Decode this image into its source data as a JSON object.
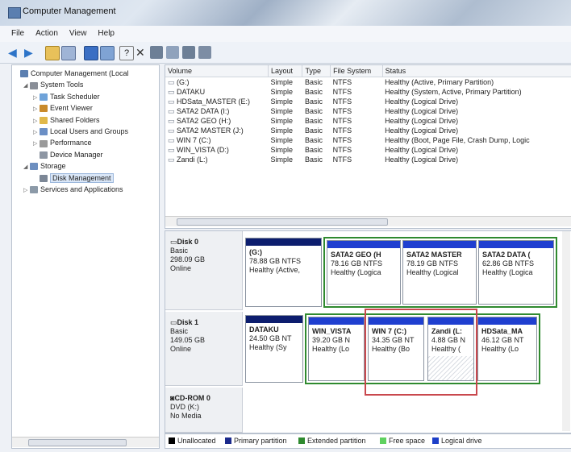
{
  "window": {
    "title": "Computer Management"
  },
  "menu": [
    "File",
    "Action",
    "View",
    "Help"
  ],
  "tree": [
    {
      "label": "Computer Management (Local",
      "level": 0,
      "icon": "computer-icon",
      "expander": ""
    },
    {
      "label": "System Tools",
      "level": 1,
      "icon": "tools-icon",
      "expander": "◢"
    },
    {
      "label": "Task Scheduler",
      "level": 2,
      "icon": "clock-icon",
      "expander": "▷"
    },
    {
      "label": "Event Viewer",
      "level": 2,
      "icon": "event-viewer-icon",
      "expander": "▷"
    },
    {
      "label": "Shared Folders",
      "level": 2,
      "icon": "folder-icon",
      "expander": "▷"
    },
    {
      "label": "Local Users and Groups",
      "level": 2,
      "icon": "users-icon",
      "expander": "▷"
    },
    {
      "label": "Performance",
      "level": 2,
      "icon": "performance-icon",
      "expander": "▷"
    },
    {
      "label": "Device Manager",
      "level": 2,
      "icon": "device-manager-icon",
      "expander": ""
    },
    {
      "label": "Storage",
      "level": 1,
      "icon": "storage-icon",
      "expander": "◢"
    },
    {
      "label": "Disk Management",
      "level": 2,
      "icon": "disk-icon",
      "expander": "",
      "selected": true
    },
    {
      "label": "Services and Applications",
      "level": 1,
      "icon": "services-icon",
      "expander": "▷"
    }
  ],
  "volumes": {
    "columns": [
      "Volume",
      "Layout",
      "Type",
      "File System",
      "Status"
    ],
    "rows": [
      [
        "(G:)",
        "Simple",
        "Basic",
        "NTFS",
        "Healthy (Active, Primary Partition)"
      ],
      [
        "DATAKU",
        "Simple",
        "Basic",
        "NTFS",
        "Healthy (System, Active, Primary Partition)"
      ],
      [
        "HDSata_MASTER (E:)",
        "Simple",
        "Basic",
        "NTFS",
        "Healthy (Logical Drive)"
      ],
      [
        "SATA2 DATA (I:)",
        "Simple",
        "Basic",
        "NTFS",
        "Healthy (Logical Drive)"
      ],
      [
        "SATA2 GEO (H:)",
        "Simple",
        "Basic",
        "NTFS",
        "Healthy (Logical Drive)"
      ],
      [
        "SATA2 MASTER (J:)",
        "Simple",
        "Basic",
        "NTFS",
        "Healthy (Logical Drive)"
      ],
      [
        "WIN 7 (C:)",
        "Simple",
        "Basic",
        "NTFS",
        "Healthy (Boot, Page File, Crash Dump, Logic"
      ],
      [
        "WIN_VISTA (D:)",
        "Simple",
        "Basic",
        "NTFS",
        "Healthy (Logical Drive)"
      ],
      [
        "Zandi (L:)",
        "Simple",
        "Basic",
        "NTFS",
        "Healthy (Logical Drive)"
      ]
    ]
  },
  "disks": [
    {
      "name": "Disk 0",
      "type": "Basic",
      "size": "298.09 GB",
      "status": "Online",
      "partitions": [
        {
          "name": "(G:)",
          "size": "78.88 GB NTFS",
          "status": "Healthy (Active,"
        },
        {
          "name": "SATA2 GEO (H",
          "size": "78.16 GB NTFS",
          "status": "Healthy (Logica"
        },
        {
          "name": "SATA2 MASTER",
          "size": "78.19 GB NTFS",
          "status": "Healthy (Logical"
        },
        {
          "name": "SATA2 DATA (",
          "size": "62.86 GB NTFS",
          "status": "Healthy (Logica"
        }
      ]
    },
    {
      "name": "Disk 1",
      "type": "Basic",
      "size": "149.05 GB",
      "status": "Online",
      "partitions": [
        {
          "name": "DATAKU",
          "size": "24.50 GB NT",
          "status": "Healthy (Sy"
        },
        {
          "name": "WIN_VISTA",
          "size": "39.20 GB N",
          "status": "Healthy (Lo"
        },
        {
          "name": "WIN 7 (C:)",
          "size": "34.35 GB NT",
          "status": "Healthy (Bo"
        },
        {
          "name": "Zandi (L:",
          "size": "4.88 GB N",
          "status": "Healthy ("
        },
        {
          "name": "HDSata_MA",
          "size": "46.12 GB NT",
          "status": "Healthy (Lo"
        }
      ]
    },
    {
      "name": "CD-ROM 0",
      "type": "DVD (K:)",
      "size": "",
      "status": "No Media"
    }
  ],
  "legend": [
    "Unallocated",
    "Primary partition",
    "Extended partition",
    "Free space",
    "Logical drive"
  ],
  "colors": {
    "unallocated": "#000000",
    "primary": "#1b2a8c",
    "extended": "#2f8a2f",
    "free": "#5fd15f",
    "logical": "#1d3fc8",
    "disk_header_primary": "#0c1d6e",
    "disk_header_logical": "#1f3fd0",
    "highlight_red": "#c9484e"
  }
}
